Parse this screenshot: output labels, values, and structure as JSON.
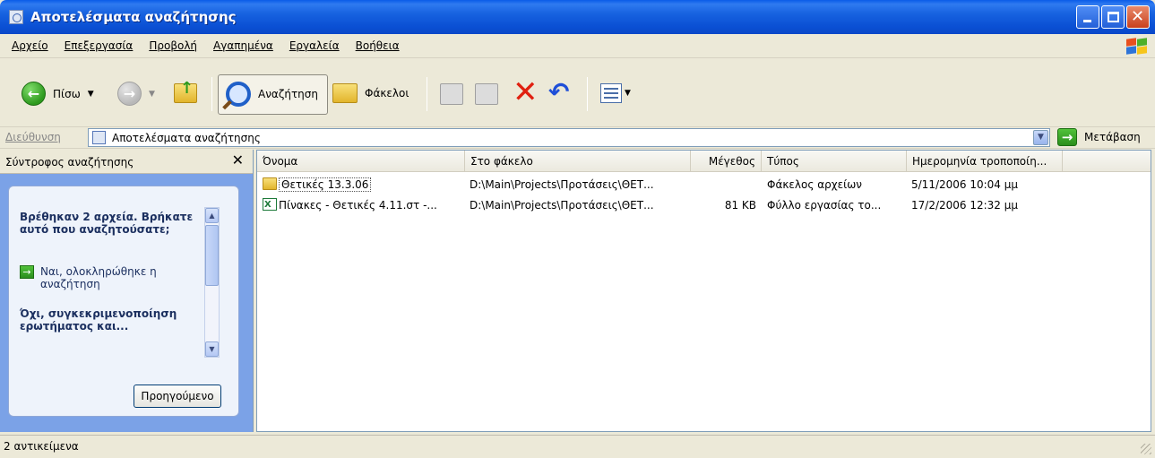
{
  "window": {
    "title": "Αποτελέσματα αναζήτησης"
  },
  "menu": [
    "Αρχείο",
    "Επεξεργασία",
    "Προβολή",
    "Αγαπημένα",
    "Εργαλεία",
    "Βοήθεια"
  ],
  "toolbar": {
    "back_label": "Πίσω",
    "search_label": "Αναζήτηση",
    "folders_label": "Φάκελοι"
  },
  "address": {
    "label": "Διεύθυνση",
    "value": "Αποτελέσματα αναζήτησης",
    "go_label": "Μετάβαση"
  },
  "search_companion": {
    "title": "Σύντροφος αναζήτησης",
    "found_text": "Βρέθηκαν 2 αρχεία. Βρήκατε αυτό που αναζητούσατε;",
    "yes_option": "Ναι, ολοκληρώθηκε η αναζήτηση",
    "no_option": "Όχι, συγκεκριμενοποίηση ερωτήματος και...",
    "previous_button": "Προηγούμενο"
  },
  "columns": [
    "Όνομα",
    "Στο φάκελο",
    "Μέγεθος",
    "Τύπος",
    "Ημερομηνία τροποποίη..."
  ],
  "files": [
    {
      "name": "Θετικές 13.3.06",
      "folder": "D:\\Main\\Projects\\Προτάσεις\\ΘΕΤ...",
      "size": "",
      "type": "Φάκελος αρχείων",
      "modified": "5/11/2006 10:04 μμ",
      "icon": "folder-icon"
    },
    {
      "name": "Πίνακες - Θετικές 4.11.στ -...",
      "folder": "D:\\Main\\Projects\\Προτάσεις\\ΘΕΤ...",
      "size": "81 KB",
      "type": "Φύλλο εργασίας το...",
      "modified": "17/2/2006 12:32 μμ",
      "icon": "excel-file-icon"
    }
  ],
  "status": {
    "text": "2 αντικείμενα"
  }
}
